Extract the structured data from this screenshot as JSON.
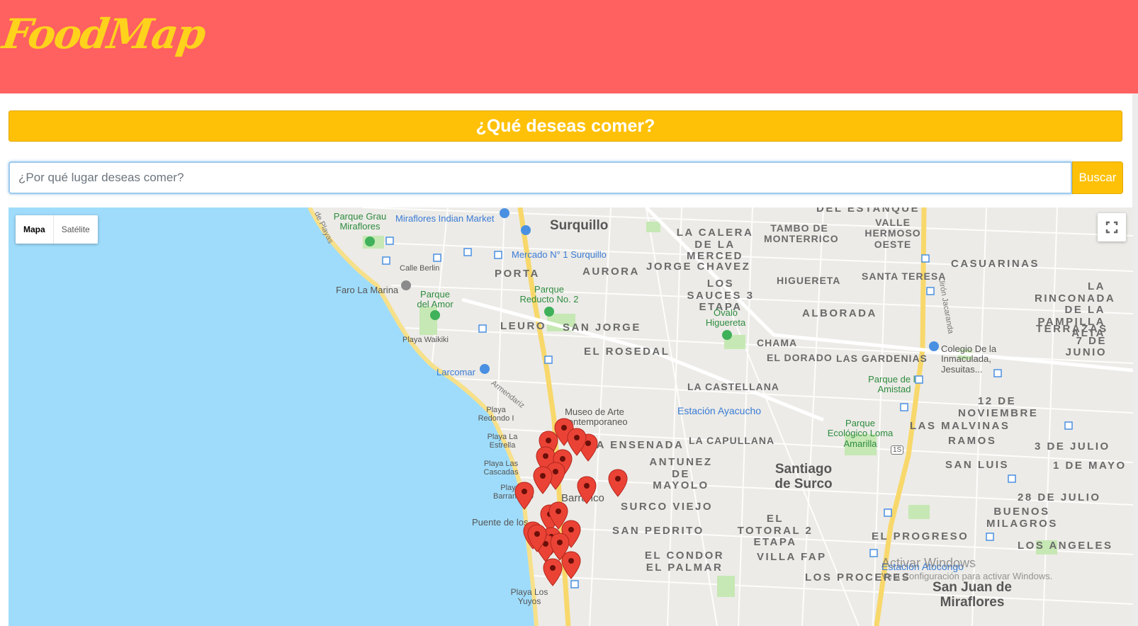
{
  "app": {
    "logo": "FoodMap"
  },
  "question": "¿Qué deseas comer?",
  "search": {
    "placeholder": "¿Por qué lugar deseas comer?",
    "value": "",
    "button_label": "Buscar"
  },
  "map": {
    "map_type": {
      "map_label": "Mapa",
      "satellite_label": "Satélite",
      "selected": "Mapa"
    },
    "labels": {
      "surquillo": "Surquillo",
      "santiago_de_surco": "Santiago de Surco",
      "barranco": "Barranco",
      "san_juan_de_miraflores": "San Juan de Miraflores",
      "del_estanque": "DEL ESTANQUE",
      "la_calera": "LA CALERA DE LA MERCED",
      "tambo": "TAMBO DE MONTERRICO",
      "valle_hermoso": "VALLE HERMOSO OESTE",
      "casuarinas": "CASUARINAS",
      "porta": "PORTA",
      "aurora": "AURORA",
      "jorge_chavez": "JORGE CHAVEZ",
      "los_sauces": "LOS SAUCES 3 ETAPA",
      "higuereta": "HIGUERETA",
      "santa_teresa": "SANTA TERESA",
      "la_rinconada": "LA RINCONADA DE LA PAMPILLA ALTA",
      "leuro": "LEURO",
      "san_jorge": "SAN JORGE",
      "alborada": "ALBORADA",
      "terrazas": "TERRAZAS 7 DE JUNIO",
      "chama": "CHAMA",
      "el_rosedal": "EL ROSEDAL",
      "el_dorado": "EL DORADO",
      "las_gardenias": "LAS GARDENIAS",
      "la_castellana": "LA CASTELLANA",
      "doce_noviembre": "12 DE NOVIEMBRE",
      "las_malvinas": "LAS MALVINAS",
      "ramos": "RAMOS",
      "la_ensenada": "LA ENSENADA",
      "la_capullana": "LA CAPULLANA",
      "tres_de_julio": "3 DE JULIO",
      "uno_de_mayo": "1 DE MAYO",
      "antunez": "ANTUNEZ DE MAYOLO",
      "san_luis": "SAN LUIS",
      "surco_viejo": "SURCO VIEJO",
      "el_totoral": "EL TOTORAL 2 ETAPA",
      "veintiocho_julio": "28 DE JULIO",
      "buenos_milagros": "BUENOS MILAGROS",
      "san_pedrito": "SAN PEDRITO",
      "el_progreso": "EL PROGRESO",
      "los_angeles": "LOS ANGELES",
      "el_condor": "EL CONDOR EL PALMAR",
      "villa_fap": "VILLA FAP",
      "los_proceres": "LOS PROCERES",
      "parque_grau": "Parque Grau Miraflores",
      "miraflores_indian": "Miraflores Indian Market",
      "mercado_surquillo": "Mercado N° 1 Surquillo",
      "calle_berlin": "Calle Berlin",
      "faro": "Faro La Marina",
      "parque_amor": "Parque del Amor",
      "parque_reducto": "Parque Reducto No. 2",
      "ovalo": "Óvalo Higuereta",
      "playa_waikiki": "Playa Waikiki",
      "larcomar": "Larcomar",
      "colegio": "Colegio De la Inmaculada, Jesuitas...",
      "parque_amistad": "Parque de la Amistad",
      "estacion_ayacucho": "Estación Ayacucho",
      "museo": "Museo de Arte Contemporaneo",
      "playa_redondo": "Playa Redondo I",
      "playa_estrella": "Playa La Estrella",
      "playa_cascadas": "Playa Las Cascadas",
      "parque_ecologico": "Parque Ecológico Loma Amarilla",
      "playa_barranquito": "Playa Barranquito",
      "puente": "Puente de los Suspiros",
      "playa_los_yuyos": "Playa Los Yuyos",
      "estacion_atocongo": "Estación Atocongo",
      "armendariz": "Armendariz",
      "jiron_jacaranda": "Jirón Jacaranda",
      "de_playas": "de Playas",
      "route_1s": "1S"
    },
    "marker_count": 22
  },
  "watermark": {
    "line1": "Activar Windows",
    "line2": "Ve a Configuración para activar Windows."
  },
  "colors": {
    "header": "#ff6060",
    "logo": "#ffd21c",
    "accent": "#ffc107",
    "water": "#9fdcfb",
    "marker": "#ea4335"
  },
  "icons": {
    "fullscreen": "fullscreen-icon",
    "marker": "map-pin-icon",
    "park": "park-pin-icon",
    "transit": "transit-station-icon"
  }
}
